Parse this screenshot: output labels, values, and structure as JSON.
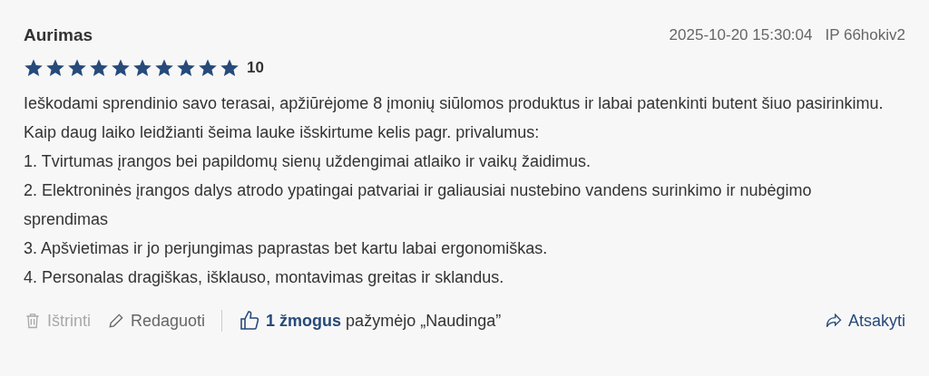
{
  "review": {
    "author": "Aurimas",
    "date": "2025-10-20 15:30:04",
    "ip": "IP 66hokiv2",
    "stars": 10,
    "score": "10",
    "paragraphs": [
      "Ieškodami sprendinio savo terasai, apžiūrėjome 8 įmonių siūlomos produktus ir labai patenkinti butent šiuo pasirinkimu. Kaip daug laiko leidžianti šeima lauke išskirtume kelis pagr. privalumus:",
      "1. Tvirtumas įrangos bei papildomų sienų uždengimai atlaiko ir vaikų žaidimus.",
      "2. Elektroninės įrangos dalys atrodo ypatingai patvariai ir galiausiai nustebino vandens surinkimo ir nubėgimo sprendimas",
      "3. Apšvietimas ir jo perjungimas paprastas bet kartu labai ergonomiškas.",
      "4. Personalas dragiškas, išklauso, montavimas greitas ir sklandus."
    ]
  },
  "actions": [
    {
      "kind": "delete",
      "label": "Ištrinti",
      "disabled": true
    },
    {
      "kind": "edit",
      "label": "Redaguoti",
      "disabled": false
    }
  ],
  "helpful": "**1 žmogus** pažymėjo „Naudinga”",
  "reply": {
    "label": "Atsakyti"
  }
}
